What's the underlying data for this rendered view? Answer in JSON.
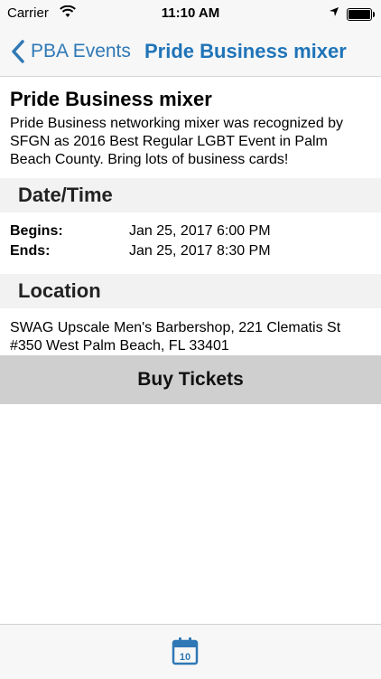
{
  "status_bar": {
    "carrier": "Carrier",
    "time": "11:10 AM",
    "icons": [
      "wifi-icon",
      "location-arrow-icon",
      "battery-icon"
    ]
  },
  "nav": {
    "back_label": "PBA Events",
    "title": "Pride Business mixer",
    "accent_color": "#2f78b5"
  },
  "event": {
    "title": "Pride Business mixer",
    "description": "Pride Business networking mixer was recognized by SFGN as 2016 Best Regular LGBT Event in Palm Beach County. Bring lots of business cards!"
  },
  "datetime": {
    "header": "Date/Time",
    "begins_label": "Begins:",
    "begins_value": "Jan 25, 2017 6:00 PM",
    "ends_label": "Ends:",
    "ends_value": "Jan 25, 2017 8:30 PM"
  },
  "location": {
    "header": "Location",
    "address": "SWAG Upscale Men's Barbershop, 221 Clematis St #350 West Palm Beach, FL 33401"
  },
  "buy": {
    "label": "Buy Tickets"
  },
  "tab_bar": {
    "calendar_day": "10",
    "icon": "calendar-icon"
  }
}
